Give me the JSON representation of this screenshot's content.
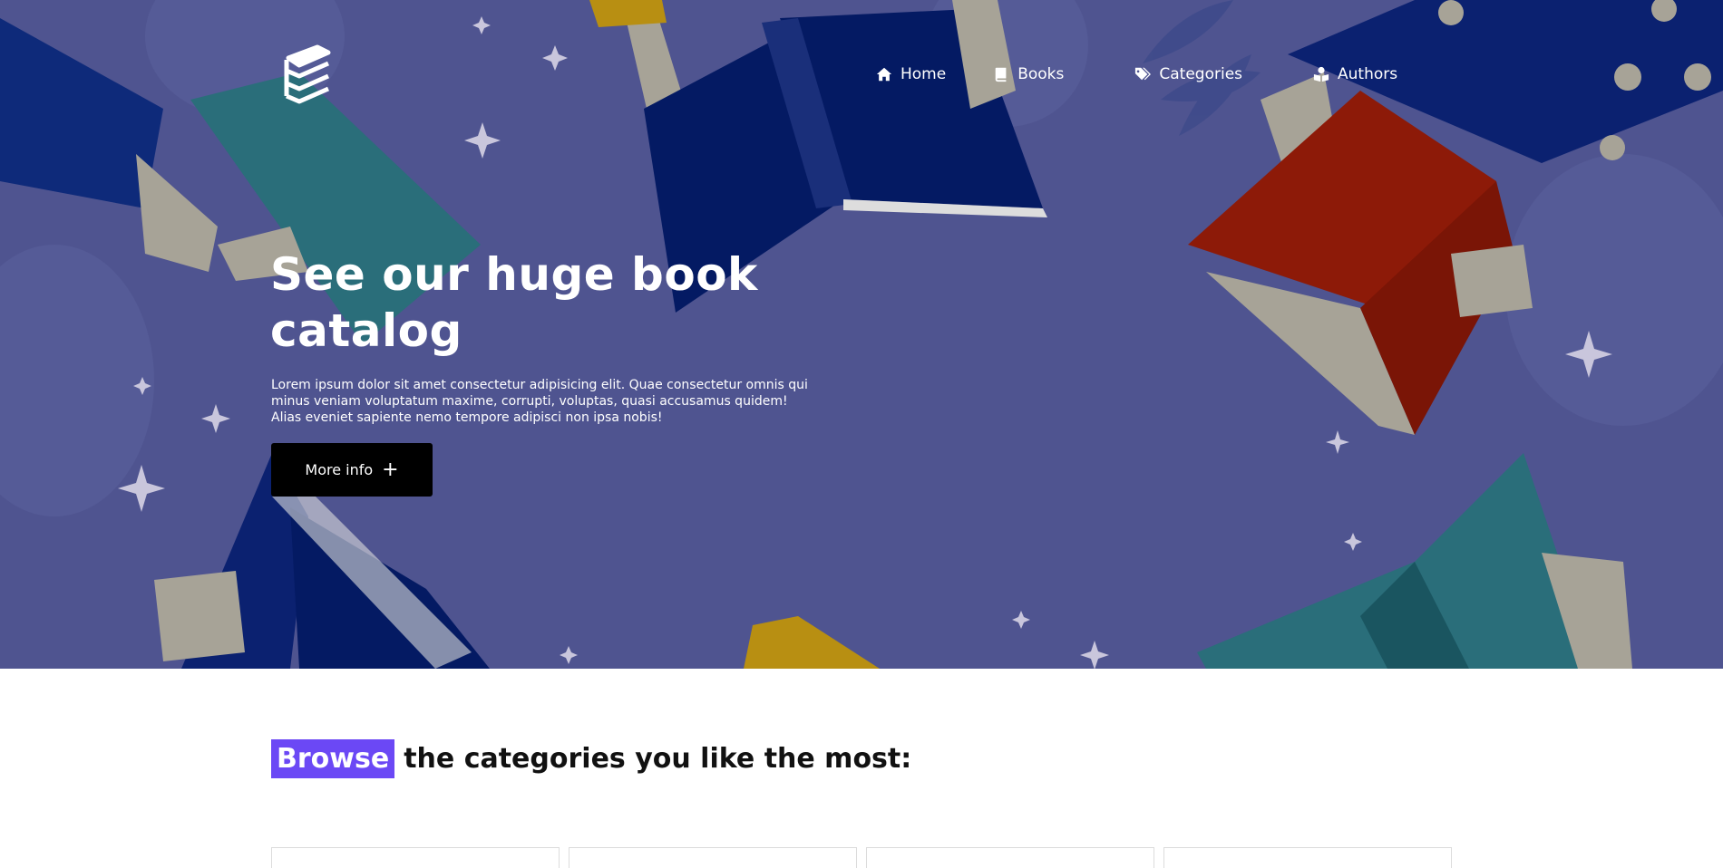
{
  "nav": {
    "items": [
      {
        "label": "Home",
        "icon": "home-icon"
      },
      {
        "label": "Books",
        "icon": "book-icon"
      },
      {
        "label": "Categories",
        "icon": "tags-icon"
      },
      {
        "label": "Authors",
        "icon": "user-book-icon"
      }
    ]
  },
  "hero": {
    "title": "See our huge book catalog",
    "text": "Lorem ipsum dolor sit amet consectetur adipisicing elit. Quae consectetur omnis qui minus veniam voluptatum maxime, corrupti, voluptas, quasi accusamus quidem! Alias eveniet sapiente nemo tempore adipisci non ipsa nobis!",
    "button_label": "More info",
    "button_icon": "plus-icon"
  },
  "browse": {
    "highlight": "Browse",
    "rest": "the categories you like the most:"
  },
  "colors": {
    "hero_bg": "#4f5490",
    "highlight": "#6b48f5",
    "button": "#000000"
  }
}
